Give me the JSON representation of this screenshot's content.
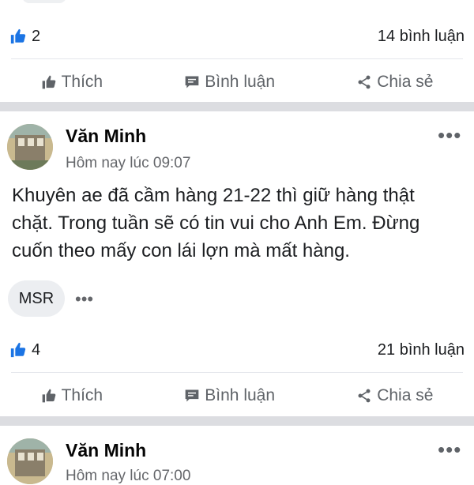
{
  "post_prev": {
    "likes": "2",
    "comments": "14 bình luận"
  },
  "actions": {
    "like": "Thích",
    "comment": "Bình luận",
    "share": "Chia sẻ"
  },
  "post_main": {
    "author": "Văn Minh",
    "time": "Hôm nay lúc 09:07",
    "text_line1": "Khuyên ae đã cầm hàng 21-22 thì giữ hàng thật",
    "text_line2": "chặt. Trong tuần sẽ có tin vui cho Anh Em. Đừng",
    "text_line3": "cuốn theo mấy con lái lợn mà mất hàng.",
    "tag": "MSR",
    "more": "•••",
    "likes": "4",
    "comments": "21 bình luận"
  },
  "post_next": {
    "author": "Văn Minh",
    "time": "Hôm nay lúc 07:00"
  },
  "menu_dots": "•••",
  "colors": {
    "accent": "#1b74e4",
    "separator": "#dcdde1"
  }
}
